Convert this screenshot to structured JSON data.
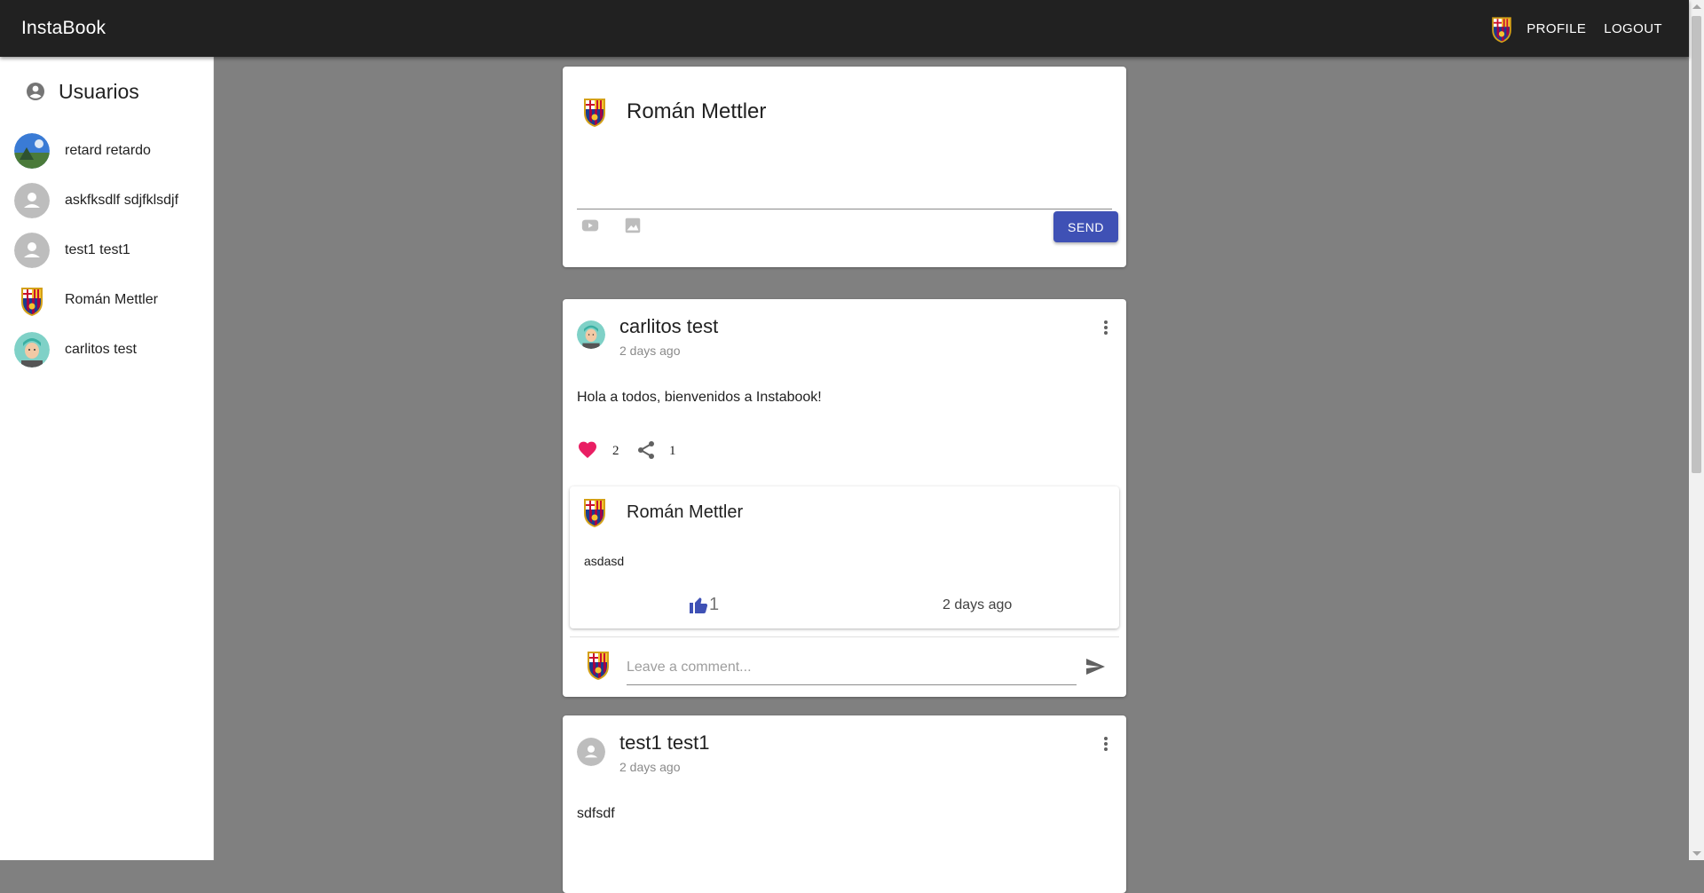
{
  "appbar": {
    "brand": "InstaBook",
    "profile_label": "PROFILE",
    "logout_label": "LOGOUT"
  },
  "sidebar": {
    "title": "Usuarios",
    "users": [
      {
        "name": "retard retardo",
        "avatar": "landscape-photo"
      },
      {
        "name": "askfksdlf sdjfklsdjf",
        "avatar": "default-person"
      },
      {
        "name": "test1 test1",
        "avatar": "default-person"
      },
      {
        "name": "Román Mettler",
        "avatar": "fc-barcelona-crest"
      },
      {
        "name": "carlitos test",
        "avatar": "cartoon-face"
      }
    ]
  },
  "composer": {
    "author": "Román Mettler",
    "send_label": "SEND"
  },
  "posts": [
    {
      "author": "carlitos test",
      "time": "2 days ago",
      "body": "Hola a todos, bienvenidos a Instabook!",
      "likes": "2",
      "shares": "1",
      "comment": {
        "author": "Román Mettler",
        "body": "asdasd",
        "likes": "1",
        "time": "2 days ago"
      },
      "comment_placeholder": "Leave a comment..."
    },
    {
      "author": "test1 test1",
      "time": "2 days ago",
      "body": "sdfsdf"
    }
  ],
  "colors": {
    "appbar": "#212121",
    "primary": "#3f51b5",
    "heart": "#e91e63",
    "background": "#808080"
  }
}
